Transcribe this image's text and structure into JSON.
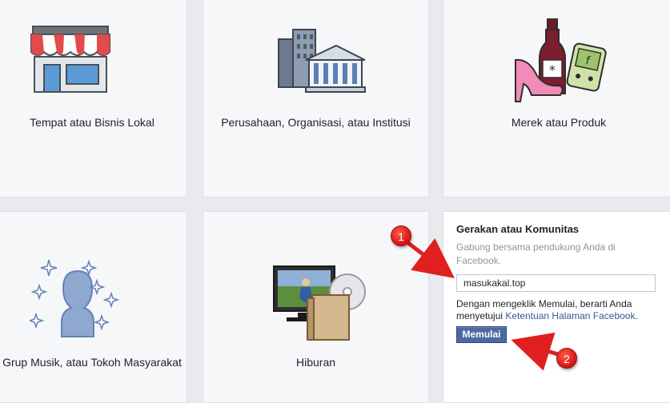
{
  "categories": [
    {
      "id": "local-business",
      "label": "Tempat atau Bisnis Lokal",
      "icon": "storefront-icon"
    },
    {
      "id": "company",
      "label": "Perusahaan, Organisasi, atau Institusi",
      "icon": "buildings-icon"
    },
    {
      "id": "brand",
      "label": "Merek atau Produk",
      "icon": "products-icon"
    },
    {
      "id": "artist",
      "label": "Grup Musik, atau Tokoh Masyarakat",
      "icon": "person-silhouette-icon"
    },
    {
      "id": "entertainment",
      "label": "Hiburan",
      "icon": "media-entertainment-icon"
    }
  ],
  "expanded": {
    "title": "Gerakan atau Komunitas",
    "subtitle": "Gabung bersama pendukung Anda di Facebook.",
    "input_value": "masukakal.top",
    "terms_prefix": "Dengan mengeklik Memulai, berarti Anda menyetujui ",
    "terms_link": "Ketentuan Halaman Facebook",
    "terms_suffix": ".",
    "button_label": "Memulai"
  },
  "annotations": {
    "marker_1": "1",
    "marker_2": "2",
    "color": "#e02020"
  }
}
